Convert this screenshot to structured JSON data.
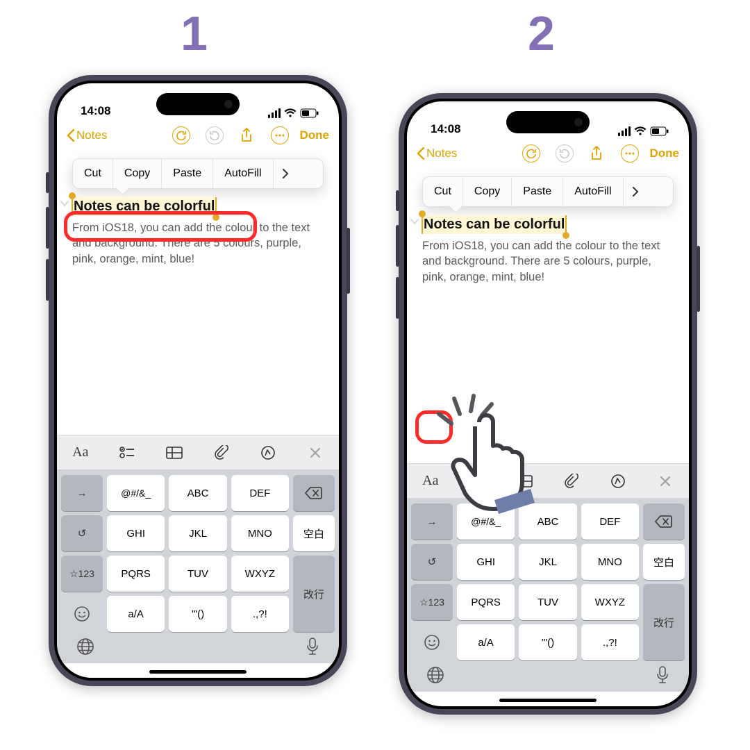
{
  "step_labels": {
    "one": "1",
    "two": "2"
  },
  "status": {
    "time": "14:08"
  },
  "nav": {
    "back": "Notes",
    "done": "Done"
  },
  "context_menu": {
    "cut": "Cut",
    "copy": "Copy",
    "paste": "Paste",
    "autofill": "AutoFill"
  },
  "note": {
    "title": "Notes can be colorful",
    "body": "From iOS18, you can add the colour to the text and background. There are 5 colours, purple, pink, orange, mint, blue!"
  },
  "format_bar": {
    "aa": "Aa"
  },
  "keyboard": {
    "left": {
      "arrow": "→",
      "undo": "↺",
      "mode": "☆123",
      "emoji": "☺"
    },
    "mid": [
      "@#/&_",
      "ABC",
      "DEF",
      "GHI",
      "JKL",
      "MNO",
      "PQRS",
      "TUV",
      "WXYZ",
      "a/A",
      "'\"()",
      ".,?!"
    ],
    "right": {
      "del": "⌫",
      "space": "空白",
      "enter": "改行"
    },
    "globe": "🌐",
    "mic": "🎤"
  },
  "colors": {
    "accent": "#E0A300",
    "step": "#8470B5",
    "highlight": "#FF2B2B"
  }
}
